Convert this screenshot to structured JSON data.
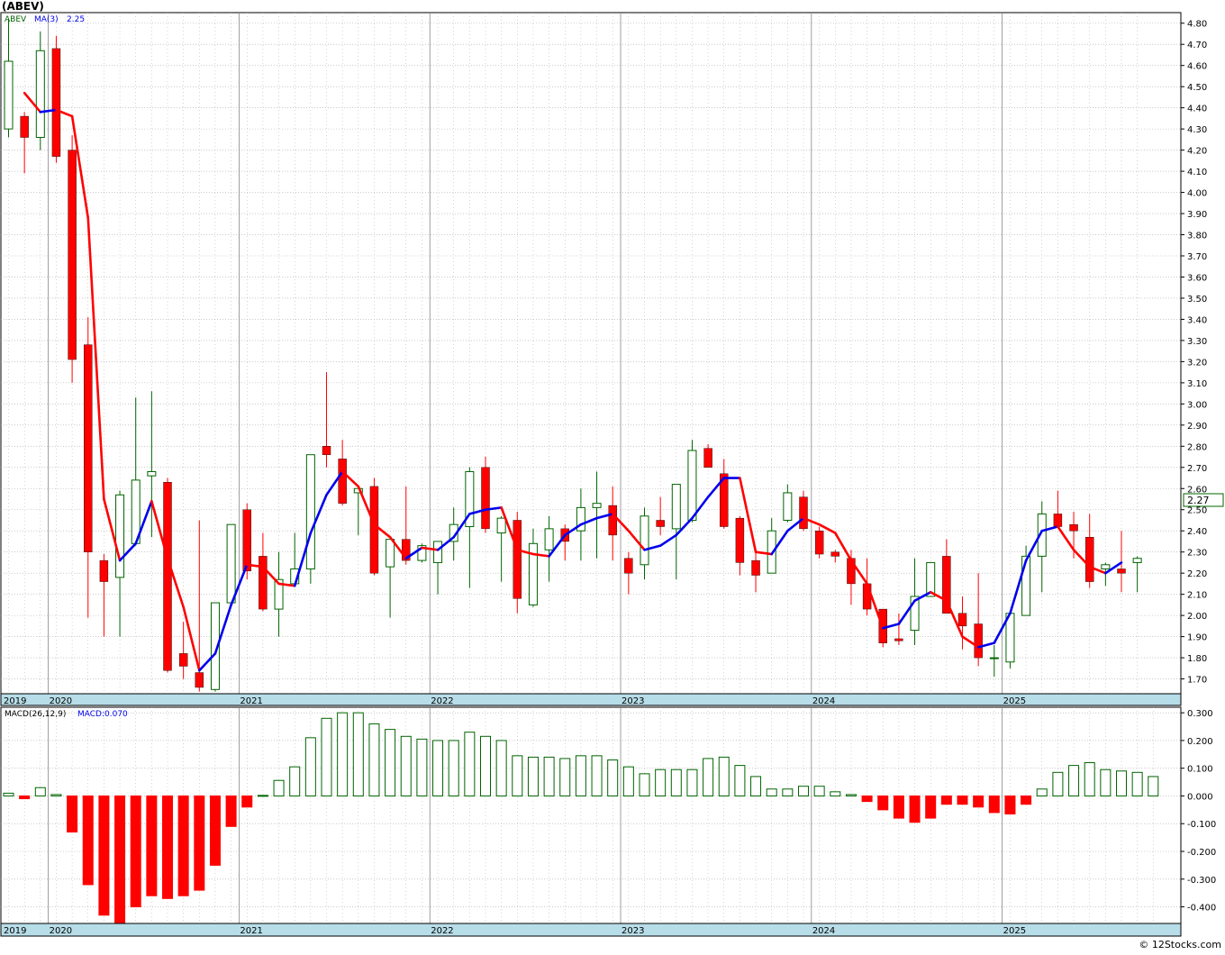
{
  "header": {
    "title": "(ABEV)"
  },
  "footer": {
    "credit": "© 12Stocks.com"
  },
  "legend": {
    "symbol": "ABEV",
    "ma_label": "MA(3)",
    "ma_value": "2.25",
    "macd_label": "MACD(26,12,9)",
    "macd_value": "MACD:0.070"
  },
  "colors": {
    "up": "#006400",
    "down": "#ff0000",
    "ma_up": "#0000ee",
    "ma_down": "#ff0000",
    "axis_band": "#b7dde8",
    "grid": "#aaaaaa",
    "last_price_border": "#006400"
  },
  "chart_data": [
    {
      "type": "candlestick",
      "interval": "monthly",
      "y_range": [
        1.63,
        4.85
      ],
      "y_ticks": [
        "1.70",
        "1.80",
        "1.90",
        "2.00",
        "2.10",
        "2.20",
        "2.30",
        "2.40",
        "2.50",
        "2.60",
        "2.70",
        "2.80",
        "2.90",
        "3.00",
        "3.10",
        "3.20",
        "3.30",
        "3.40",
        "3.50",
        "3.60",
        "3.70",
        "3.80",
        "3.90",
        "4.00",
        "4.10",
        "4.20",
        "4.30",
        "4.40",
        "4.50",
        "4.60",
        "4.70",
        "4.80"
      ],
      "x_labels": [
        "2019",
        "2020",
        "2021",
        "2022",
        "2023",
        "2024",
        "2025"
      ],
      "last_price": "2.27",
      "candles": [
        {
          "o": 4.3,
          "h": 4.82,
          "l": 4.26,
          "c": 4.62
        },
        {
          "o": 4.36,
          "h": 4.38,
          "l": 4.09,
          "c": 4.26
        },
        {
          "o": 4.26,
          "h": 4.76,
          "l": 4.2,
          "c": 4.67
        },
        {
          "o": 4.68,
          "h": 4.74,
          "l": 4.14,
          "c": 4.17
        },
        {
          "o": 4.2,
          "h": 4.27,
          "l": 3.1,
          "c": 3.21
        },
        {
          "o": 3.28,
          "h": 3.41,
          "l": 1.99,
          "c": 2.3
        },
        {
          "o": 2.26,
          "h": 2.29,
          "l": 1.9,
          "c": 2.16
        },
        {
          "o": 2.18,
          "h": 2.59,
          "l": 1.9,
          "c": 2.57
        },
        {
          "o": 2.34,
          "h": 3.03,
          "l": 2.33,
          "c": 2.64
        },
        {
          "o": 2.66,
          "h": 3.06,
          "l": 2.37,
          "c": 2.68
        },
        {
          "o": 2.63,
          "h": 2.65,
          "l": 1.73,
          "c": 1.74
        },
        {
          "o": 1.82,
          "h": 1.97,
          "l": 1.7,
          "c": 1.76
        },
        {
          "o": 1.73,
          "h": 2.45,
          "l": 1.64,
          "c": 1.66
        },
        {
          "o": 1.65,
          "h": 2.06,
          "l": 1.64,
          "c": 2.06
        },
        {
          "o": 2.06,
          "h": 2.43,
          "l": 2.07,
          "c": 2.43
        },
        {
          "o": 2.5,
          "h": 2.53,
          "l": 2.17,
          "c": 2.21
        },
        {
          "o": 2.28,
          "h": 2.39,
          "l": 2.02,
          "c": 2.03
        },
        {
          "o": 2.03,
          "h": 2.3,
          "l": 1.9,
          "c": 2.17
        },
        {
          "o": 2.15,
          "h": 2.39,
          "l": 2.14,
          "c": 2.22
        },
        {
          "o": 2.22,
          "h": 2.76,
          "l": 2.15,
          "c": 2.76
        },
        {
          "o": 2.8,
          "h": 3.15,
          "l": 2.7,
          "c": 2.76
        },
        {
          "o": 2.74,
          "h": 2.83,
          "l": 2.52,
          "c": 2.53
        },
        {
          "o": 2.58,
          "h": 2.59,
          "l": 2.38,
          "c": 2.6
        },
        {
          "o": 2.61,
          "h": 2.65,
          "l": 2.19,
          "c": 2.2
        },
        {
          "o": 2.23,
          "h": 2.36,
          "l": 1.99,
          "c": 2.36
        },
        {
          "o": 2.36,
          "h": 2.61,
          "l": 2.24,
          "c": 2.26
        },
        {
          "o": 2.26,
          "h": 2.34,
          "l": 2.25,
          "c": 2.33
        },
        {
          "o": 2.25,
          "h": 2.34,
          "l": 2.1,
          "c": 2.35
        },
        {
          "o": 2.35,
          "h": 2.51,
          "l": 2.26,
          "c": 2.43
        },
        {
          "o": 2.42,
          "h": 2.7,
          "l": 2.13,
          "c": 2.68
        },
        {
          "o": 2.7,
          "h": 2.75,
          "l": 2.39,
          "c": 2.41
        },
        {
          "o": 2.39,
          "h": 2.47,
          "l": 2.16,
          "c": 2.46
        },
        {
          "o": 2.45,
          "h": 2.49,
          "l": 2.01,
          "c": 2.08
        },
        {
          "o": 2.05,
          "h": 2.41,
          "l": 2.04,
          "c": 2.34
        },
        {
          "o": 2.31,
          "h": 2.47,
          "l": 2.16,
          "c": 2.41
        },
        {
          "o": 2.41,
          "h": 2.43,
          "l": 2.26,
          "c": 2.35
        },
        {
          "o": 2.4,
          "h": 2.6,
          "l": 2.26,
          "c": 2.51
        },
        {
          "o": 2.51,
          "h": 2.68,
          "l": 2.27,
          "c": 2.53
        },
        {
          "o": 2.52,
          "h": 2.61,
          "l": 2.26,
          "c": 2.38
        },
        {
          "o": 2.27,
          "h": 2.3,
          "l": 2.1,
          "c": 2.2
        },
        {
          "o": 2.24,
          "h": 2.51,
          "l": 2.17,
          "c": 2.47
        },
        {
          "o": 2.45,
          "h": 2.56,
          "l": 2.38,
          "c": 2.42
        },
        {
          "o": 2.41,
          "h": 2.6,
          "l": 2.17,
          "c": 2.62
        },
        {
          "o": 2.45,
          "h": 2.83,
          "l": 2.44,
          "c": 2.78
        },
        {
          "o": 2.79,
          "h": 2.81,
          "l": 2.71,
          "c": 2.7
        },
        {
          "o": 2.67,
          "h": 2.74,
          "l": 2.41,
          "c": 2.42
        },
        {
          "o": 2.46,
          "h": 2.47,
          "l": 2.19,
          "c": 2.25
        },
        {
          "o": 2.26,
          "h": 2.3,
          "l": 2.11,
          "c": 2.19
        },
        {
          "o": 2.2,
          "h": 2.46,
          "l": 2.2,
          "c": 2.4
        },
        {
          "o": 2.45,
          "h": 2.62,
          "l": 2.44,
          "c": 2.58
        },
        {
          "o": 2.56,
          "h": 2.59,
          "l": 2.4,
          "c": 2.41
        },
        {
          "o": 2.4,
          "h": 2.42,
          "l": 2.27,
          "c": 2.29
        },
        {
          "o": 2.3,
          "h": 2.31,
          "l": 2.25,
          "c": 2.28
        },
        {
          "o": 2.27,
          "h": 2.31,
          "l": 2.05,
          "c": 2.15
        },
        {
          "o": 2.15,
          "h": 2.27,
          "l": 2.0,
          "c": 2.03
        },
        {
          "o": 2.03,
          "h": 2.03,
          "l": 1.85,
          "c": 1.87
        },
        {
          "o": 1.89,
          "h": 2.01,
          "l": 1.86,
          "c": 1.88
        },
        {
          "o": 1.93,
          "h": 2.27,
          "l": 1.86,
          "c": 2.09
        },
        {
          "o": 2.09,
          "h": 2.25,
          "l": 2.09,
          "c": 2.25
        },
        {
          "o": 2.28,
          "h": 2.36,
          "l": 2.01,
          "c": 2.01
        },
        {
          "o": 2.01,
          "h": 2.09,
          "l": 1.84,
          "c": 1.95
        },
        {
          "o": 1.96,
          "h": 2.2,
          "l": 1.76,
          "c": 1.8
        },
        {
          "o": 1.8,
          "h": 1.86,
          "l": 1.71,
          "c": 1.8
        },
        {
          "o": 1.78,
          "h": 2.01,
          "l": 1.75,
          "c": 2.01
        },
        {
          "o": 2.0,
          "h": 2.33,
          "l": 2.0,
          "c": 2.28
        },
        {
          "o": 2.28,
          "h": 2.54,
          "l": 2.11,
          "c": 2.48
        },
        {
          "o": 2.48,
          "h": 2.59,
          "l": 2.42,
          "c": 2.42
        },
        {
          "o": 2.43,
          "h": 2.49,
          "l": 2.27,
          "c": 2.4
        },
        {
          "o": 2.37,
          "h": 2.48,
          "l": 2.13,
          "c": 2.16
        },
        {
          "o": 2.22,
          "h": 2.25,
          "l": 2.14,
          "c": 2.24
        },
        {
          "o": 2.22,
          "h": 2.4,
          "l": 2.11,
          "c": 2.2
        },
        {
          "o": 2.25,
          "h": 2.28,
          "l": 2.11,
          "c": 2.27
        }
      ],
      "ma3": [
        4.47,
        4.38,
        4.39,
        4.36,
        3.88,
        2.55,
        2.26,
        2.34,
        2.54,
        2.27,
        2.04,
        1.74,
        1.82,
        2.05,
        2.24,
        2.23,
        2.15,
        2.14,
        2.39,
        2.57,
        2.68,
        2.61,
        2.43,
        2.37,
        2.27,
        2.32,
        2.31,
        2.37,
        2.48,
        2.5,
        2.51,
        2.31,
        2.29,
        2.28,
        2.38,
        2.43,
        2.46,
        2.48,
        2.4,
        2.31,
        2.33,
        2.38,
        2.46,
        2.56,
        2.65,
        2.65,
        2.3,
        2.29,
        2.4,
        2.46,
        2.43,
        2.39,
        2.26,
        2.15,
        1.94,
        1.96,
        2.07,
        2.11,
        2.07,
        1.9,
        1.85,
        1.87,
        2.01,
        2.26,
        2.4,
        2.42,
        2.31,
        2.23,
        2.2,
        2.25
      ],
      "ma3_start_index": 1
    },
    {
      "type": "bar",
      "name": "MACD",
      "y_range": [
        -0.46,
        0.32
      ],
      "y_ticks": [
        "0.300",
        "0.200",
        "0.100",
        "0.000",
        "-0.100",
        "-0.200",
        "-0.300",
        "-0.400"
      ],
      "values": [
        0.01,
        -0.01,
        0.03,
        0.005,
        -0.13,
        -0.32,
        -0.43,
        -0.46,
        -0.4,
        -0.36,
        -0.37,
        -0.36,
        -0.34,
        -0.25,
        -0.11,
        -0.04,
        0.002,
        0.056,
        0.105,
        0.21,
        0.28,
        0.3,
        0.3,
        0.26,
        0.24,
        0.215,
        0.205,
        0.2,
        0.2,
        0.23,
        0.215,
        0.2,
        0.145,
        0.14,
        0.14,
        0.135,
        0.145,
        0.145,
        0.13,
        0.105,
        0.08,
        0.095,
        0.095,
        0.095,
        0.135,
        0.14,
        0.11,
        0.07,
        0.025,
        0.025,
        0.035,
        0.035,
        0.015,
        0.005,
        -0.02,
        -0.05,
        -0.08,
        -0.095,
        -0.08,
        -0.03,
        -0.03,
        -0.04,
        -0.06,
        -0.065,
        -0.03,
        0.025,
        0.085,
        0.11,
        0.12,
        0.095,
        0.09,
        0.085,
        0.07
      ]
    }
  ]
}
